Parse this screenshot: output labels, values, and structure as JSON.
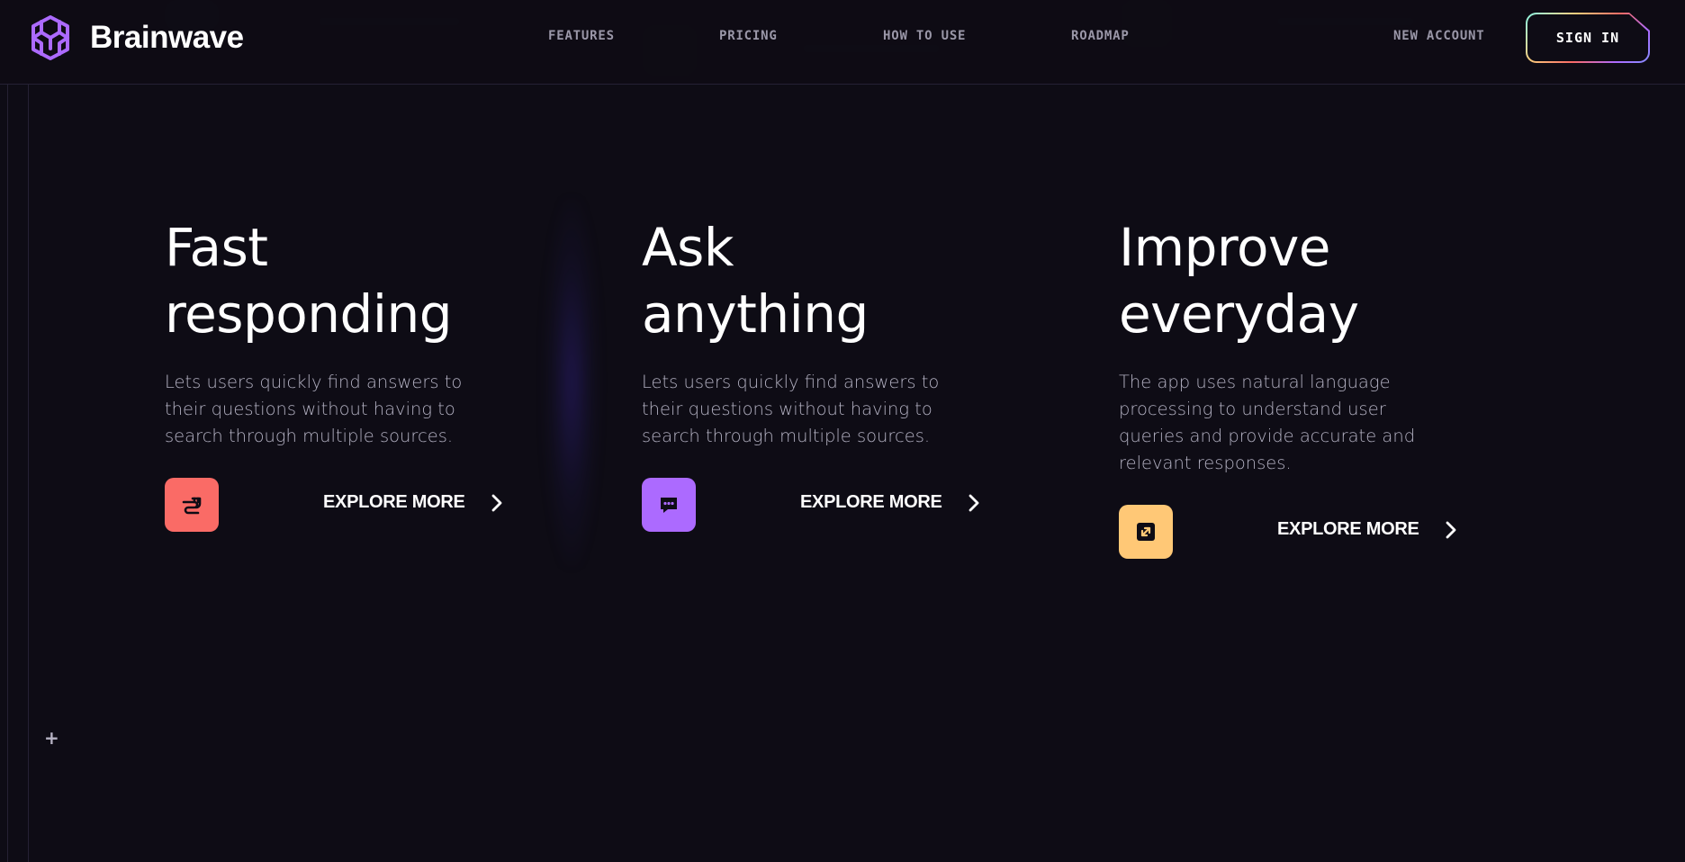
{
  "brand": {
    "name": "Brainwave",
    "accent": "#ac6aff"
  },
  "nav": {
    "items": [
      {
        "label": "FEATURES"
      },
      {
        "label": "PRICING"
      },
      {
        "label": "HOW TO USE"
      },
      {
        "label": "ROADMAP"
      }
    ],
    "new_account": "NEW ACCOUNT",
    "sign_in": "SIGN IN"
  },
  "cards": [
    {
      "title_line1": "Fast",
      "title_line2": "responding",
      "description": "Lets users quickly find answers to their questions without having to search through multiple sources.",
      "cta": "EXPLORE MORE",
      "icon": "plug-icon",
      "icon_color": "#fa6b66"
    },
    {
      "title_line1": "Ask",
      "title_line2": "anything",
      "description": "Lets users quickly find answers to their questions without having to search through multiple sources.",
      "cta": "EXPLORE MORE",
      "icon": "chat-icon",
      "icon_color": "#ac6aff"
    },
    {
      "title_line1": "Improve",
      "title_line2": "everyday",
      "description": "The app uses natural language processing to understand user queries and provide accurate and relevant responses.",
      "cta": "EXPLORE MORE",
      "icon": "expand-icon",
      "icon_color": "#ffc876"
    }
  ],
  "decor": {
    "plus_icon": "plus-icon"
  }
}
